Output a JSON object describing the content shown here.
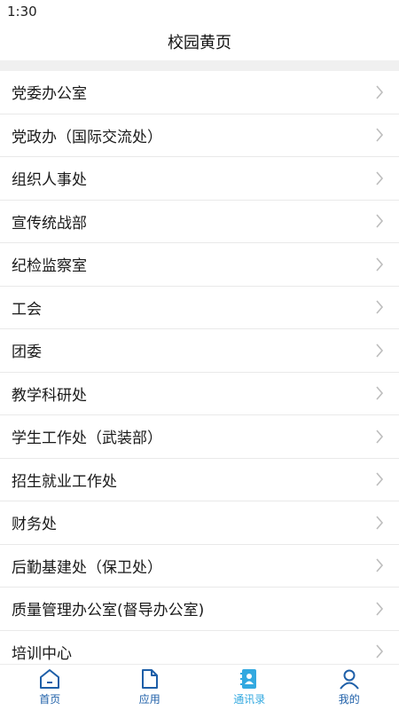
{
  "status_bar": {
    "time": "1:30"
  },
  "header": {
    "title": "校园黄页"
  },
  "list": {
    "items": [
      {
        "label": "党委办公室"
      },
      {
        "label": "党政办（国际交流处）"
      },
      {
        "label": "组织人事处"
      },
      {
        "label": "宣传统战部"
      },
      {
        "label": "纪检监察室"
      },
      {
        "label": "工会"
      },
      {
        "label": "团委"
      },
      {
        "label": "教学科研处"
      },
      {
        "label": "学生工作处（武装部）"
      },
      {
        "label": "招生就业工作处"
      },
      {
        "label": "财务处"
      },
      {
        "label": "后勤基建处（保卫处）"
      },
      {
        "label": "质量管理办公室(督导办公室)"
      },
      {
        "label": "培训中心"
      }
    ]
  },
  "tabs": [
    {
      "label": "首页",
      "icon": "home-icon"
    },
    {
      "label": "应用",
      "icon": "document-icon"
    },
    {
      "label": "通讯录",
      "icon": "contacts-icon",
      "active": true
    },
    {
      "label": "我的",
      "icon": "user-icon"
    }
  ],
  "colors": {
    "tab_default": "#1e5fa8",
    "tab_active": "#33a9e0",
    "divider": "#e9e9e9",
    "band": "#f0f0f0"
  }
}
